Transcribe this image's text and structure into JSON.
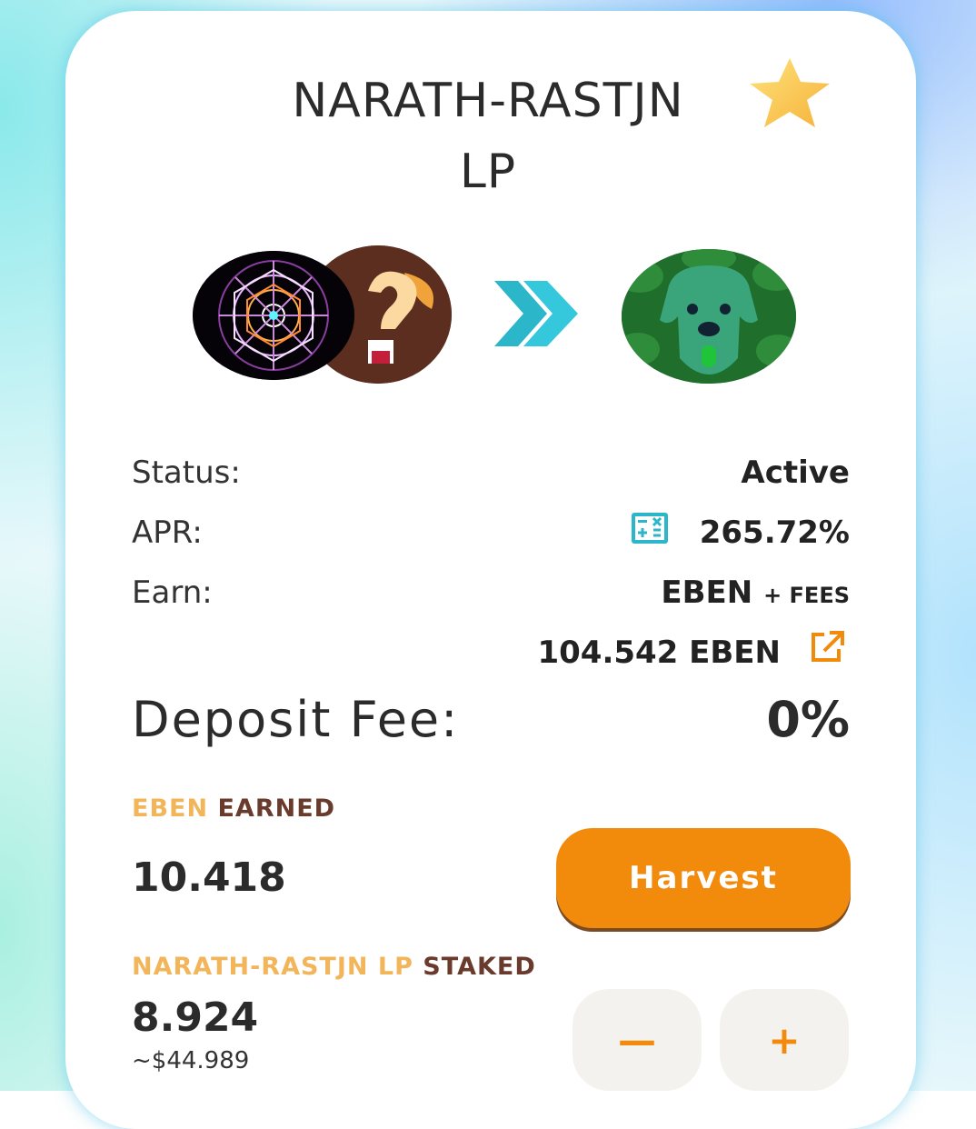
{
  "farm": {
    "title_line1": "NARATH-RASTJN",
    "title_line2": "LP",
    "favorite_icon": "star-icon"
  },
  "tokens": {
    "icons": [
      "token-mandala-icon",
      "token-question-icon",
      "double-arrow-icon",
      "token-dog-icon"
    ]
  },
  "details": {
    "status_label": "Status:",
    "status_value": "Active",
    "apr_label": "APR:",
    "apr_value": "265.72%",
    "earn_label": "Earn:",
    "earn_token": "EBEN",
    "earn_suffix": "+ FEES",
    "reward_amount": "104.542 EBEN",
    "deposit_fee_label": "Deposit Fee:",
    "deposit_fee_value": "0%"
  },
  "earned": {
    "token": "EBEN",
    "label": "EARNED",
    "amount": "10.418",
    "harvest_label": "Harvest"
  },
  "staked": {
    "token": "NARATH-RASTJN LP",
    "label": "STAKED",
    "amount": "8.924",
    "usd_value": "~$44.989",
    "minus_label": "—",
    "plus_label": "+"
  },
  "colors": {
    "accent": "#f28a0c",
    "label_orange": "#f2b55a",
    "label_brown": "#6a3b2c",
    "icon_teal": "#2bb6c9"
  }
}
